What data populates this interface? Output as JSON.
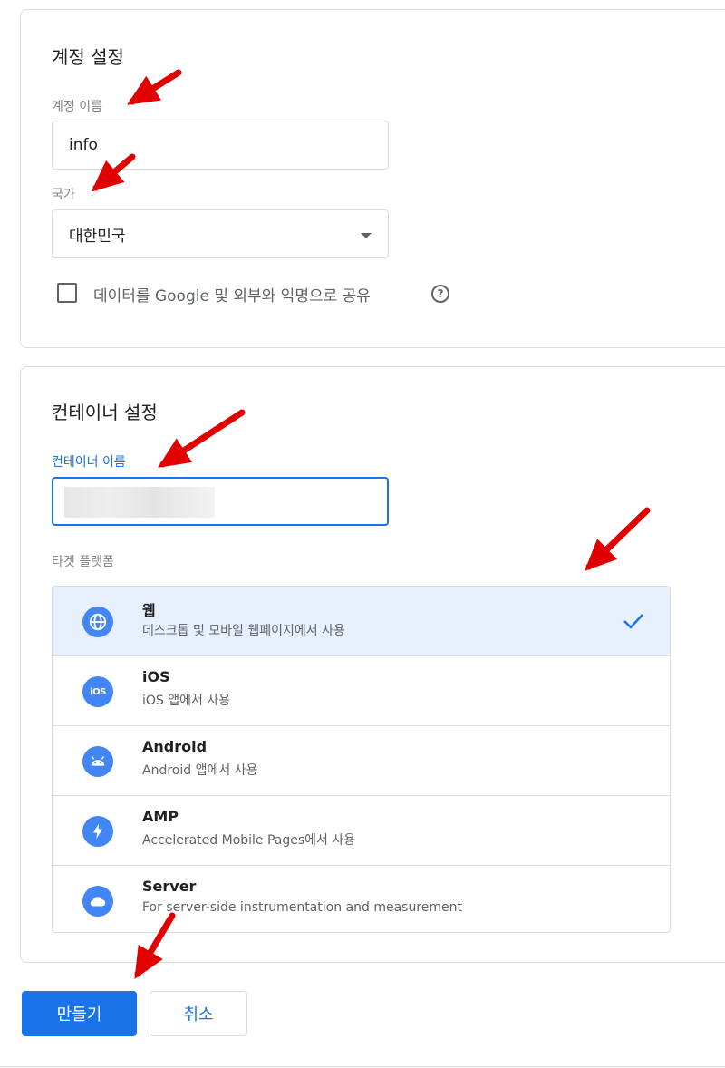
{
  "account": {
    "title": "계정 설정",
    "name_label": "계정 이름",
    "name_value": "info",
    "country_label": "국가",
    "country_value": "대한민국",
    "share_label": "데이터를 Google 및 외부와 익명으로 공유",
    "help_glyph": "?"
  },
  "container": {
    "title": "컨테이너 설정",
    "name_label": "컨테이너 이름",
    "target_label": "타겟 플랫폼",
    "platforms": [
      {
        "name": "웹",
        "desc": "데스크톱 및 모바일 웹페이지에서 사용",
        "icon": "globe-icon",
        "selected": true
      },
      {
        "name": "iOS",
        "desc": "iOS 앱에서 사용",
        "icon": "ios-icon",
        "selected": false
      },
      {
        "name": "Android",
        "desc": "Android 앱에서 사용",
        "icon": "android-icon",
        "selected": false
      },
      {
        "name": "AMP",
        "desc": "Accelerated Mobile Pages에서 사용",
        "icon": "lightning-icon",
        "selected": false
      },
      {
        "name": "Server",
        "desc": "For server-side instrumentation and measurement",
        "icon": "cloud-icon",
        "selected": false
      }
    ],
    "ios_icon_text": "iOS"
  },
  "actions": {
    "create_label": "만들기",
    "cancel_label": "취소"
  },
  "colors": {
    "accent": "#1a73e8",
    "icon_blue": "#4285f4",
    "selected_row": "#e8f0fe",
    "annotation_arrow": "#e00000"
  }
}
